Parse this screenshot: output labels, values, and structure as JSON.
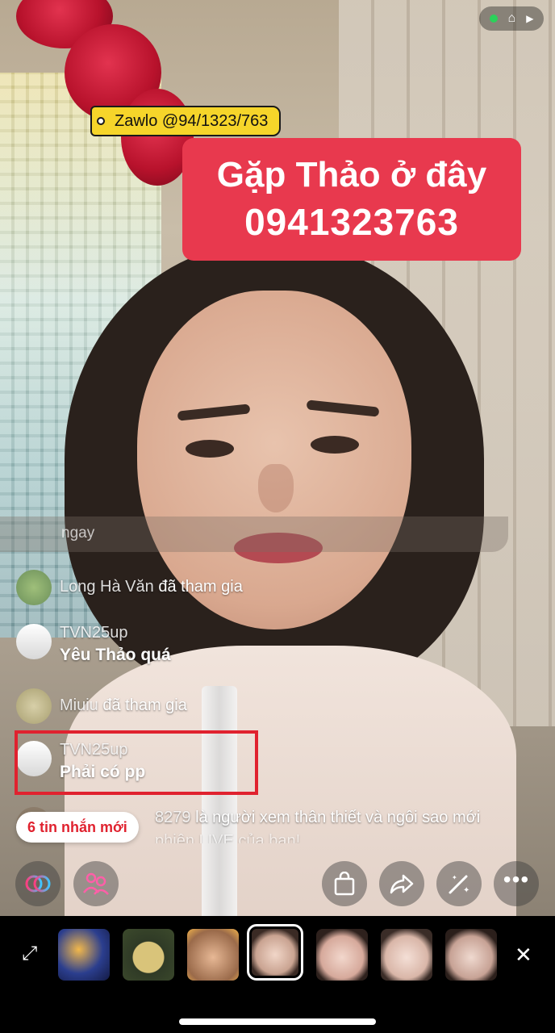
{
  "status": {
    "live_dot_color": "#2bd15a",
    "icons": [
      "house-icon",
      "play-icon"
    ]
  },
  "tag": {
    "text": "Zawlo @94/1323/763"
  },
  "promo": {
    "line1": "Gặp Thảo ở đây",
    "line2": "0941323763"
  },
  "chat": {
    "faded": "ngay",
    "rows": [
      {
        "name": "Long Hà Văn",
        "text": "đã tham gia"
      },
      {
        "name": "TVN25up",
        "text": "Yêu Thảo quá"
      },
      {
        "name": "Miuiu",
        "text": "đã tham gia"
      },
      {
        "name": "TVN25up",
        "text": "Phải có pp"
      },
      {
        "name": "8279",
        "text": "là người xem thân thiết và ngôi sao mới"
      },
      {
        "text": "phiên LIVE của bạn!"
      }
    ]
  },
  "new_messages": "6 tin nhắn mới",
  "actions": [
    "link-icon",
    "people-icon",
    "bag-icon",
    "share-icon",
    "magic-wand-icon",
    "more-icon"
  ],
  "filters": [
    "filter-mystic",
    "filter-cartoon-face",
    "filter-puppy",
    "filter-natural",
    "filter-beauty",
    "filter-flower",
    "filter-soft"
  ],
  "colors": {
    "accent_red": "#e8394e",
    "tag_yellow": "#f6d52a",
    "highlight": "#e0222f"
  }
}
